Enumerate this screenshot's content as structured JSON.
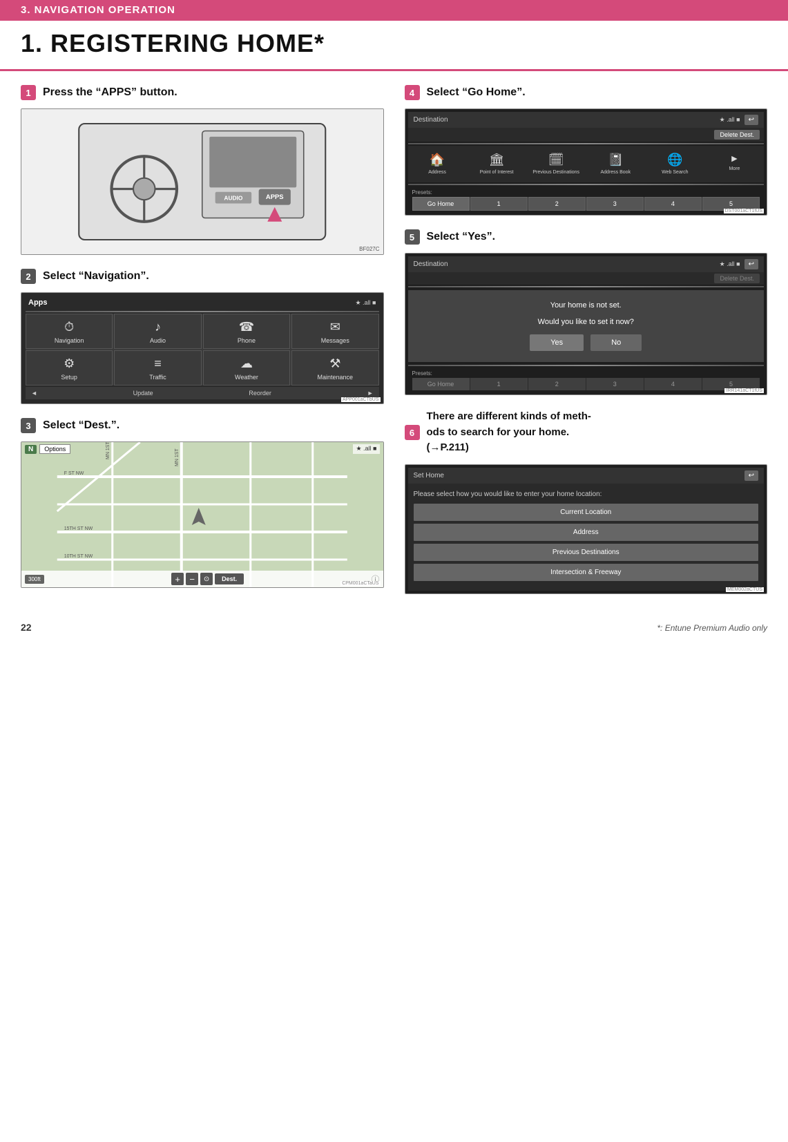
{
  "header": {
    "section": "3. NAVIGATION OPERATION",
    "title": "1. REGISTERING HOME*"
  },
  "steps": [
    {
      "number": "1",
      "title": "Press the “APPS” button.",
      "diagram_label": "BF027C",
      "apps_btn_label": "APPS",
      "audio_btn_label": "AUDIO"
    },
    {
      "number": "2",
      "title": "Select “Navigation”.",
      "screen_label": "APP001aCTbUS",
      "screen_title": "Apps",
      "status": "★★.all ■",
      "apps": [
        {
          "icon": "⏲",
          "label": "Navigation"
        },
        {
          "icon": "♫",
          "label": "Audio"
        },
        {
          "icon": "☎",
          "label": "Phone"
        },
        {
          "icon": "✉",
          "label": "Messages"
        },
        {
          "icon": "⚙",
          "label": "Setup"
        },
        {
          "icon": "≡",
          "label": "Traffic"
        },
        {
          "icon": "☁",
          "label": "Weather"
        },
        {
          "icon": "⚒",
          "label": "Maintenance"
        }
      ],
      "footer": [
        "◄",
        "Update",
        "Reorder",
        "►"
      ]
    },
    {
      "number": "3",
      "title": "Select “Dest.”.",
      "screen_label": "CPM001aCTaUS",
      "map_scale": "300ft",
      "map_n_btn": "N",
      "map_options_btn": "Options",
      "map_dest_btn": "Dest."
    },
    {
      "number": "4",
      "title": "Select “Go Home”.",
      "screen_label": "DST001aCT1fUS",
      "dest_title": "Destination",
      "delete_btn": "Delete Dest.",
      "dest_icons": [
        {
          "icon": "⌂",
          "label": "Address"
        },
        {
          "icon": "🏛",
          "label": "Point of\nInterest"
        },
        {
          "icon": "🗓",
          "label": "Previous\nDestinations"
        },
        {
          "icon": "📓",
          "label": "Address\nBook"
        },
        {
          "icon": "🌐",
          "label": "Web\nSearch"
        },
        {
          "icon": "►",
          "label": "More"
        }
      ],
      "presets_label": "Presets:",
      "presets": [
        "Go Home",
        "1",
        "2",
        "3",
        "4",
        "5"
      ]
    },
    {
      "number": "5",
      "title": "Select “Yes”.",
      "screen_label": "IRR141aCT1fUS",
      "dest_title": "Destination",
      "dialog_line1": "Your home is not set.",
      "dialog_line2": "Would you like to set it now?",
      "yes_btn": "Yes",
      "no_btn": "No",
      "presets_label": "Presets:",
      "presets": [
        "Go Home",
        "1",
        "2",
        "3",
        "4",
        "5"
      ]
    },
    {
      "number": "6",
      "title_line1": "There are different kinds of meth-",
      "title_line2": "ods to search for your home.",
      "title_line3": "(→P.211)",
      "screen_label": "MEM002aCTUS",
      "sethome_title": "Set Home",
      "sethome_prompt": "Please select how you would like to enter your home location:",
      "sethome_btns": [
        "Current Location",
        "Address",
        "Previous Destinations",
        "Intersection & Freeway"
      ]
    }
  ],
  "footer": {
    "page_number": "22",
    "footnote": "*: Entune Premium Audio only"
  }
}
